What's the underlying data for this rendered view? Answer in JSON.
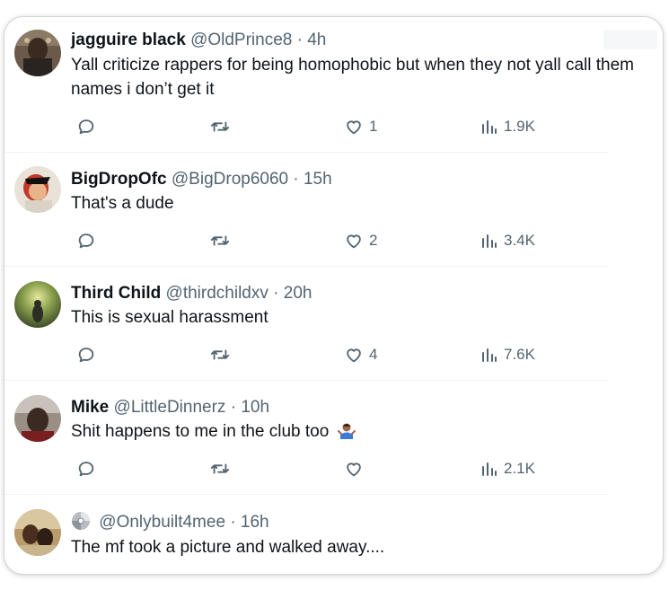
{
  "tweets": [
    {
      "name": "jagguire black",
      "handle": "@OldPrince8",
      "time": "4h",
      "text": "Yall criticize rappers for being homophobic but when they not yall call them names i don’t get it",
      "likes": "1",
      "views": "1.9K"
    },
    {
      "name": "BigDropOfc",
      "handle": "@BigDrop6060",
      "time": "15h",
      "text": "That's a dude",
      "likes": "2",
      "views": "3.4K"
    },
    {
      "name": "Third Child",
      "handle": "@thirdchildxv",
      "time": "20h",
      "text": "This is sexual harassment",
      "likes": "4",
      "views": "7.6K"
    },
    {
      "name": "Mike",
      "handle": "@LittleDinnerz",
      "time": "10h",
      "text": "Shit happens to me in the club too",
      "likes": "",
      "views": "2.1K"
    },
    {
      "name": "",
      "handle": "@Onlybuilt4mee",
      "time": "16h",
      "text": "The mf took a picture and walked away...."
    }
  ],
  "separator": "·",
  "colors": {
    "text": "#0f1419",
    "muted": "#536471",
    "divider": "#eff3f4"
  },
  "icons": [
    "reply-icon",
    "retweet-icon",
    "like-icon",
    "views-icon",
    "person-shrugging-emoji",
    "cd-disc-icon"
  ]
}
